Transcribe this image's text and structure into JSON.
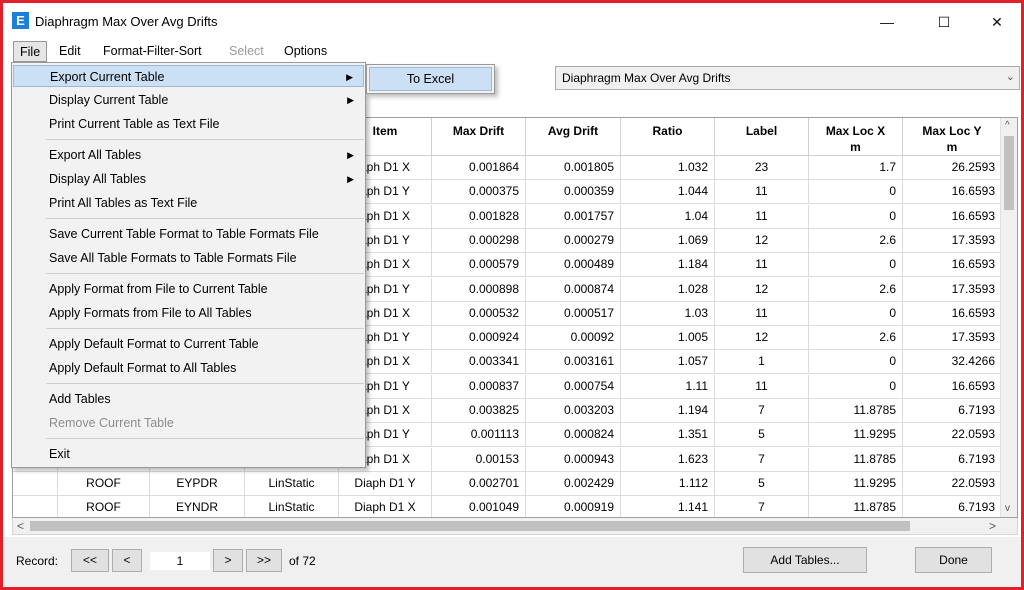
{
  "window": {
    "title": "Diaphragm Max Over Avg Drifts",
    "app_icon_letter": "E",
    "minimize": "—",
    "maximize": "☐",
    "close": "✕"
  },
  "menubar": {
    "file": "File",
    "edit": "Edit",
    "format": "Format-Filter-Sort",
    "select": "Select",
    "options": "Options"
  },
  "table_selector": {
    "value": "Diaphragm Max Over Avg Drifts"
  },
  "file_menu": {
    "items": [
      {
        "label": "Export Current Table",
        "submenu": true
      },
      {
        "label": "Display Current Table",
        "submenu": true
      },
      {
        "label": "Print Current Table as Text File"
      },
      {
        "label": "Export All Tables",
        "submenu": true
      },
      {
        "label": "Display All Tables",
        "submenu": true
      },
      {
        "label": "Print All Tables as Text File"
      },
      {
        "label": "Save Current Table Format to Table Formats File"
      },
      {
        "label": "Save All Table Formats to Table Formats File"
      },
      {
        "label": "Apply Format from File to Current Table"
      },
      {
        "label": "Apply Formats from File to All Tables"
      },
      {
        "label": "Apply Default Format to Current Table"
      },
      {
        "label": "Apply Default Format to All Tables"
      },
      {
        "label": "Add Tables"
      },
      {
        "label": "Remove Current Table",
        "disabled": true
      },
      {
        "label": "Exit"
      }
    ],
    "submenu_arrow": "▶"
  },
  "export_submenu": {
    "to_excel": "To Excel"
  },
  "table": {
    "headers": {
      "item": "Item",
      "max_drift": "Max Drift",
      "avg_drift": "Avg Drift",
      "ratio": "Ratio",
      "label": "Label",
      "max_loc_x": "Max Loc X",
      "max_loc_x_unit": "m",
      "max_loc_y": "Max Loc Y",
      "max_loc_y_unit": "m"
    },
    "rows": [
      {
        "story": "",
        "case": "",
        "type": "",
        "item": "aph D1 X",
        "max_drift": "0.001864",
        "avg_drift": "0.001805",
        "ratio": "1.032",
        "label": "23",
        "x": "1.7",
        "y": "26.2593"
      },
      {
        "story": "",
        "case": "",
        "type": "",
        "item": "aph D1 Y",
        "max_drift": "0.000375",
        "avg_drift": "0.000359",
        "ratio": "1.044",
        "label": "11",
        "x": "0",
        "y": "16.6593"
      },
      {
        "story": "",
        "case": "",
        "type": "",
        "item": "aph D1 X",
        "max_drift": "0.001828",
        "avg_drift": "0.001757",
        "ratio": "1.04",
        "label": "11",
        "x": "0",
        "y": "16.6593"
      },
      {
        "story": "",
        "case": "",
        "type": "",
        "item": "aph D1 Y",
        "max_drift": "0.000298",
        "avg_drift": "0.000279",
        "ratio": "1.069",
        "label": "12",
        "x": "2.6",
        "y": "17.3593"
      },
      {
        "story": "",
        "case": "",
        "type": "",
        "item": "aph D1 X",
        "max_drift": "0.000579",
        "avg_drift": "0.000489",
        "ratio": "1.184",
        "label": "11",
        "x": "0",
        "y": "16.6593"
      },
      {
        "story": "",
        "case": "",
        "type": "",
        "item": "aph D1 Y",
        "max_drift": "0.000898",
        "avg_drift": "0.000874",
        "ratio": "1.028",
        "label": "12",
        "x": "2.6",
        "y": "17.3593"
      },
      {
        "story": "",
        "case": "",
        "type": "",
        "item": "aph D1 X",
        "max_drift": "0.000532",
        "avg_drift": "0.000517",
        "ratio": "1.03",
        "label": "11",
        "x": "0",
        "y": "16.6593"
      },
      {
        "story": "",
        "case": "",
        "type": "",
        "item": "aph D1 Y",
        "max_drift": "0.000924",
        "avg_drift": "0.00092",
        "ratio": "1.005",
        "label": "12",
        "x": "2.6",
        "y": "17.3593"
      },
      {
        "story": "",
        "case": "",
        "type": "",
        "item": "aph D1 X",
        "max_drift": "0.003341",
        "avg_drift": "0.003161",
        "ratio": "1.057",
        "label": "1",
        "x": "0",
        "y": "32.4266"
      },
      {
        "story": "",
        "case": "",
        "type": "",
        "item": "aph D1 Y",
        "max_drift": "0.000837",
        "avg_drift": "0.000754",
        "ratio": "1.11",
        "label": "11",
        "x": "0",
        "y": "16.6593"
      },
      {
        "story": "",
        "case": "",
        "type": "",
        "item": "aph D1 X",
        "max_drift": "0.003825",
        "avg_drift": "0.003203",
        "ratio": "1.194",
        "label": "7",
        "x": "11.8785",
        "y": "6.7193"
      },
      {
        "story": "",
        "case": "",
        "type": "",
        "item": "aph D1 Y",
        "max_drift": "0.001113",
        "avg_drift": "0.000824",
        "ratio": "1.351",
        "label": "5",
        "x": "11.9295",
        "y": "22.0593"
      },
      {
        "story": "",
        "case": "",
        "type": "",
        "item": "aph D1 X",
        "max_drift": "0.00153",
        "avg_drift": "0.000943",
        "ratio": "1.623",
        "label": "7",
        "x": "11.8785",
        "y": "6.7193"
      },
      {
        "story": "ROOF",
        "case": "EYPDR",
        "type": "LinStatic",
        "item": "Diaph D1 Y",
        "max_drift": "0.002701",
        "avg_drift": "0.002429",
        "ratio": "1.112",
        "label": "5",
        "x": "11.9295",
        "y": "22.0593"
      },
      {
        "story": "ROOF",
        "case": "EYNDR",
        "type": "LinStatic",
        "item": "Diaph D1 X",
        "max_drift": "0.001049",
        "avg_drift": "0.000919",
        "ratio": "1.141",
        "label": "7",
        "x": "11.8785",
        "y": "6.7193"
      }
    ]
  },
  "scroll": {
    "left": "<",
    "right": ">",
    "up": "^",
    "down": "v"
  },
  "bottom": {
    "record_label": "Record:",
    "first": "<<",
    "prev": "<",
    "record_value": "1",
    "next": ">",
    "last": ">>",
    "of_text": "of 72",
    "add_tables": "Add Tables...",
    "done": "Done"
  }
}
